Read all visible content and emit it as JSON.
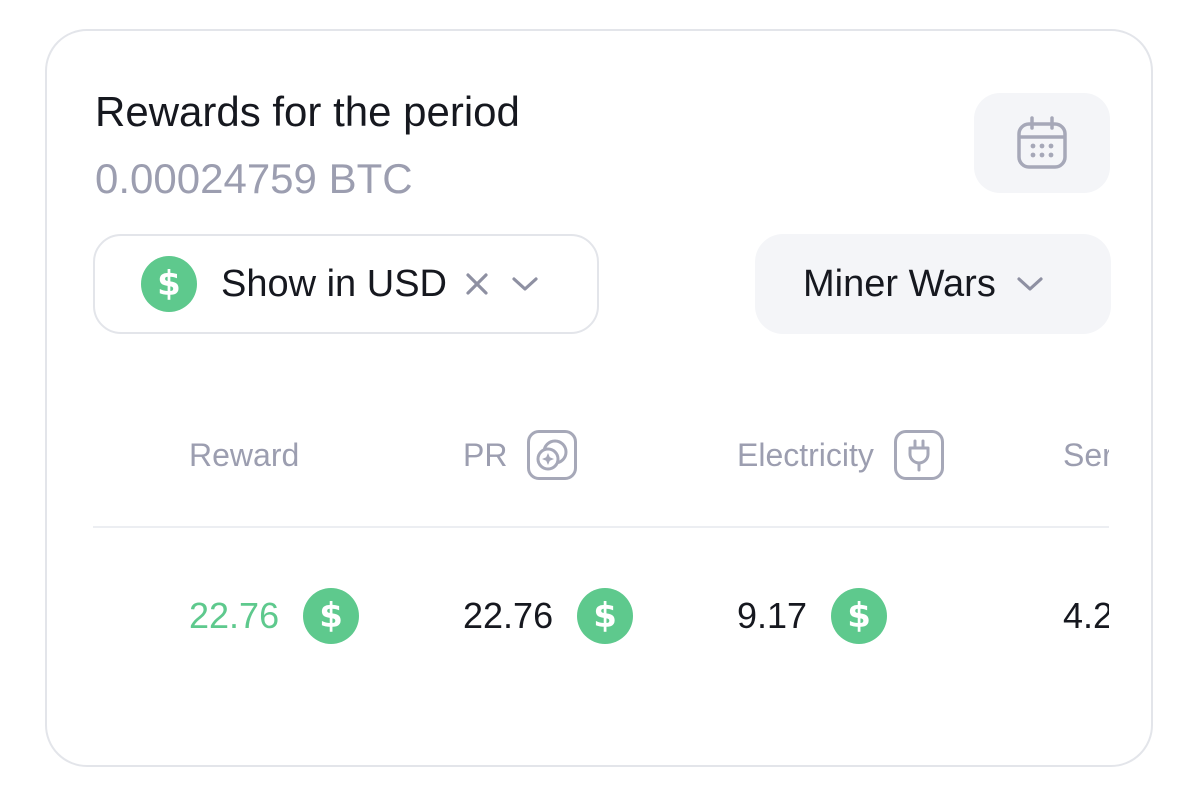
{
  "header": {
    "title": "Rewards for the period",
    "amount": "0.00024759 BTC"
  },
  "filters": {
    "currency_label": "Show in USD",
    "game_label": "Miner Wars"
  },
  "table": {
    "columns": [
      {
        "label": "Reward",
        "icon": null
      },
      {
        "label": "PR",
        "icon": "pr-coins-icon"
      },
      {
        "label": "Electricity",
        "icon": "plug-icon"
      },
      {
        "label": "Ser",
        "icon": null
      }
    ],
    "rows": [
      {
        "reward": "22.76",
        "pr": "22.76",
        "electricity": "9.17",
        "service": "4.2"
      }
    ],
    "currency_symbol": "$"
  },
  "colors": {
    "accent_green": "#5ec98d",
    "muted_text": "#9c9eb0",
    "text": "#16181f",
    "surface": "#f4f5f8"
  }
}
